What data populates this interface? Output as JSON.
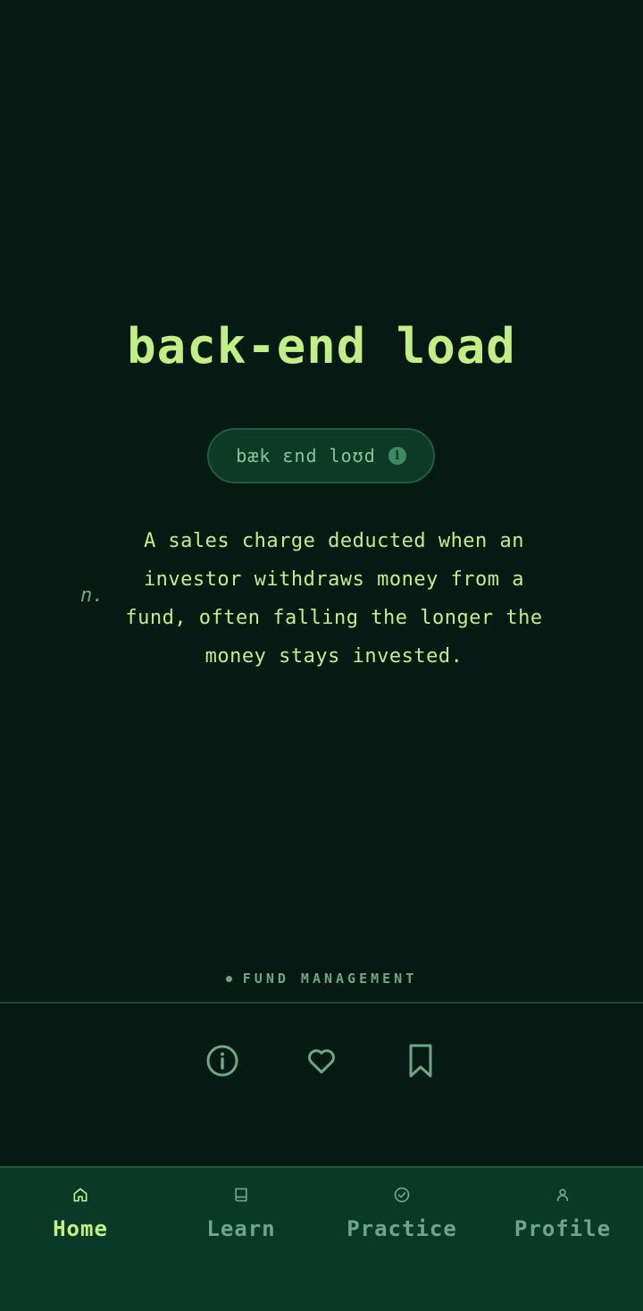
{
  "term": "back-end load",
  "pronunciation": "bæk ɛnd loʊd",
  "part_of_speech": "n.",
  "definition": "A sales charge deducted when an investor withdraws money from a fund, often falling the longer the money stays invested.",
  "category": "FUND MANAGEMENT",
  "actions": [
    {
      "icon": "info-circle-icon"
    },
    {
      "icon": "heart-icon"
    },
    {
      "icon": "bookmark-icon"
    }
  ],
  "tabs": [
    {
      "label": "Home",
      "icon": "home-icon",
      "active": true
    },
    {
      "label": "Learn",
      "icon": "book-icon",
      "active": false
    },
    {
      "label": "Practice",
      "icon": "check-circle-icon",
      "active": false
    },
    {
      "label": "Profile",
      "icon": "user-icon",
      "active": false
    }
  ],
  "colors": {
    "background": "#041a12",
    "accent": "#c2ef84",
    "muted": "#6da78a",
    "tabbar": "#0a3a27"
  }
}
